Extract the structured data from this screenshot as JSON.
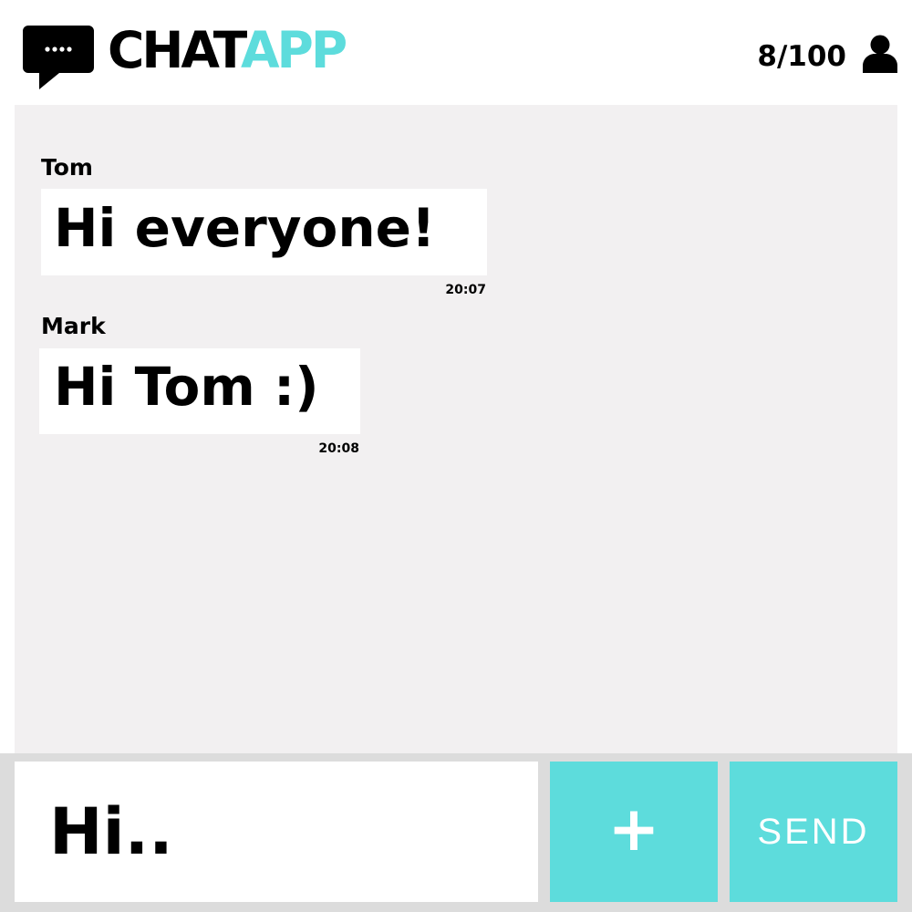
{
  "header": {
    "logo_chat": "CHAT",
    "logo_app": "APP",
    "user_count": "8/100",
    "logo_icon": "chat-bubble-icon",
    "user_icon": "user-icon"
  },
  "messages": [
    {
      "sender": "Tom",
      "text": "Hi everyone!",
      "time": "20:07"
    },
    {
      "sender": "Mark",
      "text": "Hi Tom :)",
      "time": "20:08"
    }
  ],
  "composer": {
    "input_value": "Hi..",
    "plus_label": "+",
    "send_label": "SEND"
  },
  "colors": {
    "accent": "#5ddcdc",
    "chat_background": "#f2f0f1",
    "composer_background": "#dcdcdc",
    "bubble": "#ffffff",
    "text": "#000000"
  }
}
